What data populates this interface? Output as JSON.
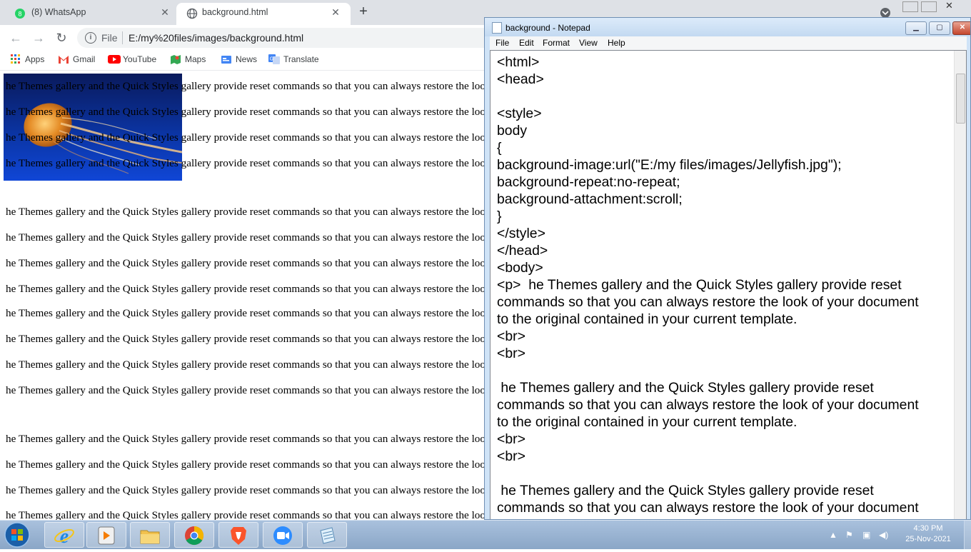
{
  "browser": {
    "tabs": [
      {
        "title": "(8) WhatsApp",
        "icon": "whatsapp-icon",
        "active": false
      },
      {
        "title": "background.html",
        "icon": "globe-icon",
        "active": true
      }
    ],
    "omnibox": {
      "scheme_label": "File",
      "url": "E:/my%20files/images/background.html"
    },
    "bookmarks": [
      {
        "label": "Apps",
        "icon": "apps-grid-icon"
      },
      {
        "label": "Gmail",
        "icon": "gmail-icon"
      },
      {
        "label": "YouTube",
        "icon": "youtube-icon"
      },
      {
        "label": "Maps",
        "icon": "maps-icon"
      },
      {
        "label": "News",
        "icon": "news-icon"
      },
      {
        "label": "Translate",
        "icon": "translate-icon"
      }
    ]
  },
  "page": {
    "paragraph_text": "he Themes gallery and the Quick Styles gallery provide reset commands so that you can always restore the look of your document to the original contained in your current template."
  },
  "notepad": {
    "title": "background - Notepad",
    "menu": [
      "File",
      "Edit",
      "Format",
      "View",
      "Help"
    ],
    "lines": [
      "<html>",
      "<head>",
      "",
      "<style>",
      "body",
      "{",
      "background-image:url(\"E:/my files/images/Jellyfish.jpg\");",
      "background-repeat:no-repeat;",
      "background-attachment:scroll;",
      "}",
      "</style>",
      "</head>",
      "<body>",
      "<p>  he Themes gallery and the Quick Styles gallery provide reset",
      "commands so that you can always restore the look of your document",
      "to the original contained in your current template.",
      "<br>",
      "<br>",
      "",
      " he Themes gallery and the Quick Styles gallery provide reset",
      "commands so that you can always restore the look of your document",
      "to the original contained in your current template.",
      "<br>",
      "<br>",
      "",
      " he Themes gallery and the Quick Styles gallery provide reset",
      "commands so that you can always restore the look of your document"
    ]
  },
  "taskbar": {
    "apps": [
      "internet-explorer-icon",
      "media-player-icon",
      "file-explorer-icon",
      "chrome-icon",
      "brave-icon",
      "zoom-icon",
      "notepad-icon"
    ],
    "time": "4:30 PM",
    "date": "25-Nov-2021"
  },
  "colors": {
    "accent_green": "#0f9d58",
    "taskbar": "#9bb5d4",
    "notepad_frame": "#cfe3f7"
  }
}
